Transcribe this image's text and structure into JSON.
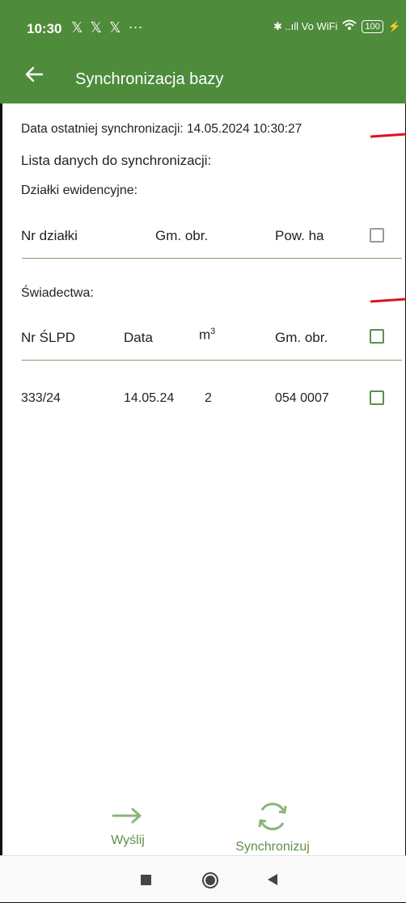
{
  "status_bar": {
    "time": "10:30",
    "notification_icons": "𝕏 𝕏 𝕏 ⋯",
    "system_icons": "✱ ..ıll Vo WiFi",
    "battery": "100"
  },
  "app_bar": {
    "title": "Synchronizacja bazy"
  },
  "sync_info": {
    "last_sync": "Data ostatniej synchronizacji: 14.05.2024 10:30:27",
    "list_heading": "Lista danych do synchronizacji:"
  },
  "plots_section": {
    "label": "Działki ewidencyjne:",
    "columns": [
      "Nr działki",
      "Gm. obr.",
      "Pow. ha"
    ]
  },
  "certificates_section": {
    "label": "Świadectwa:",
    "columns": [
      "Nr ŚLPD",
      "Data",
      "m",
      "Gm. obr."
    ],
    "m_superscript": "3",
    "rows": [
      {
        "nr": "333/24",
        "data": "14.05.24",
        "m3": "2",
        "gm_obr": "054 0007"
      }
    ]
  },
  "actions": {
    "send_label": "Wyślij",
    "sync_label": "Synchronizuj"
  },
  "colors": {
    "primary": "#4e8b3a",
    "accent": "#5d8f4c",
    "annotation": "#e01020"
  }
}
